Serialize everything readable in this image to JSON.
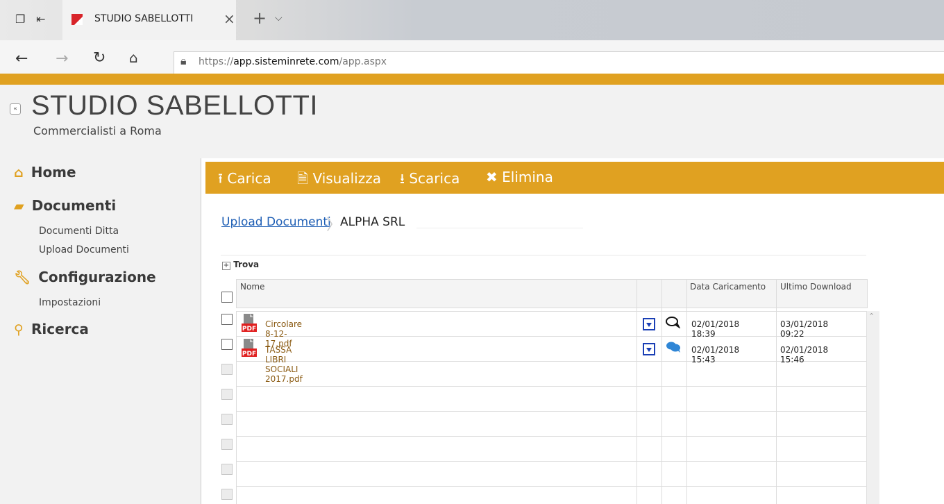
{
  "browser": {
    "tab_title": "STUDIO SABELLOTTI",
    "url_scheme": "https://",
    "url_host": "app.sisteminrete.com",
    "url_path": "/app.aspx"
  },
  "header": {
    "title": "STUDIO SABELLOTTI",
    "subtitle": "Commercialisti a Roma"
  },
  "sidebar": {
    "home": "Home",
    "documenti": "Documenti",
    "documenti_items": [
      "Documenti Ditta",
      "Upload Documenti"
    ],
    "configurazione": "Configurazione",
    "configurazione_items": [
      "Impostazioni"
    ],
    "ricerca": "Ricerca"
  },
  "toolbar": {
    "carica": "Carica",
    "visualizza": "Visualizza",
    "scarica": "Scarica",
    "elimina": "Elimina"
  },
  "breadcrumb": {
    "link": "Upload Documenti",
    "current": "ALPHA SRL"
  },
  "search": {
    "label": "Trova"
  },
  "grid": {
    "columns": {
      "name": "Nome",
      "uploaded": "Data Caricamento",
      "downloaded": "Ultimo Download"
    },
    "rows": [
      {
        "name": "Circolare 8-12-17.pdf",
        "uploaded": "02/01/2018 18:39",
        "downloaded": "03/01/2018 09:22",
        "comment_icon": "comment-outline-icon"
      },
      {
        "name": "TASSA LIBRI SOCIALI 2017.pdf",
        "uploaded": "02/01/2018 15:43",
        "downloaded": "02/01/2018 15:46",
        "comment_icon": "comment-filled-icon"
      }
    ]
  },
  "colors": {
    "accent": "#e0a121",
    "link": "#1f5fb5",
    "filename": "#8a5a12"
  }
}
